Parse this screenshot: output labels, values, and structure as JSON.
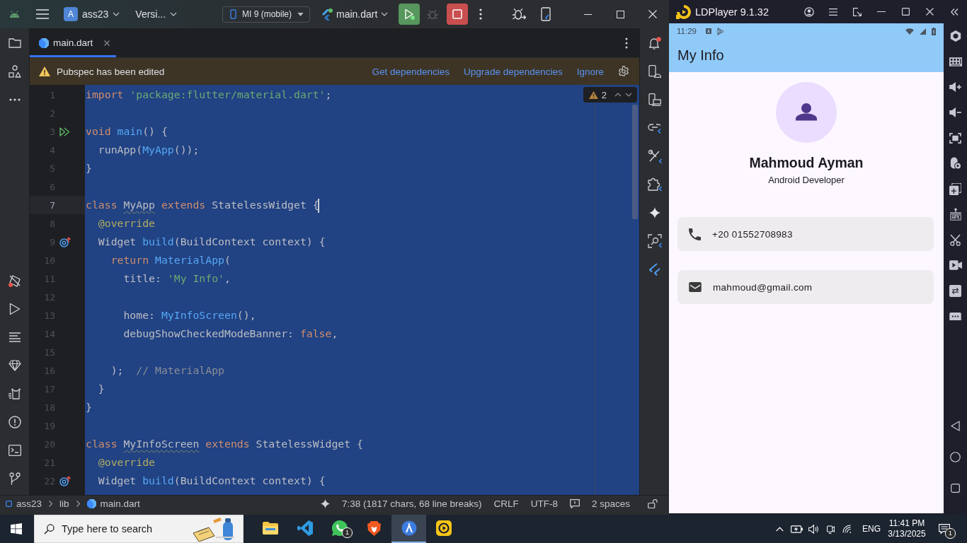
{
  "ide": {
    "title_bar": {
      "project_badge": "A",
      "project": "ass23",
      "vcs": "Versi...",
      "device": "MI 9 (mobile)",
      "run_config": "main.dart",
      "app_running": true,
      "actions": [
        {
          "kind": "run",
          "disabled": false
        },
        {
          "kind": "debug",
          "disabled": true
        },
        {
          "kind": "stop",
          "disabled": false
        }
      ]
    },
    "notifications": {
      "unread": true
    },
    "tabs": [
      {
        "label": "main.dart",
        "selected": true
      }
    ],
    "banner": {
      "message": "Pubspec has been edited",
      "actions": [
        "Get dependencies",
        "Upgrade dependencies",
        "Ignore"
      ]
    },
    "inspection": {
      "warnings": "2"
    },
    "code": {
      "lines": [
        {
          "number": "1",
          "kind": "plain",
          "current": false,
          "tokens": [
            {
              "text": "import ",
              "kind": "keyword"
            },
            {
              "text": "'package:flutter/material.dart'",
              "kind": "string"
            },
            {
              "text": ";",
              "kind": "plain"
            }
          ]
        },
        {
          "number": "2",
          "kind": "plain",
          "current": false
        },
        {
          "number": "3",
          "kind": "run",
          "current": false,
          "tokens": [
            {
              "text": "void ",
              "kind": "keyword"
            },
            {
              "text": "main",
              "kind": "function"
            },
            {
              "text": "() {",
              "kind": "plain"
            }
          ]
        },
        {
          "number": "4",
          "kind": "plain",
          "current": false,
          "tokens": [
            {
              "text": "  runApp(",
              "kind": "plain"
            },
            {
              "text": "MyApp",
              "kind": "function"
            },
            {
              "text": "());",
              "kind": "plain"
            }
          ]
        },
        {
          "number": "5",
          "kind": "plain",
          "current": false,
          "tokens": [
            {
              "text": "}",
              "kind": "plain"
            }
          ]
        },
        {
          "number": "6",
          "kind": "plain",
          "current": false
        },
        {
          "number": "7",
          "kind": "plain",
          "current": true,
          "tokens": [
            {
              "text": "class ",
              "kind": "keyword"
            },
            {
              "text": "MyApp",
              "kind": "warned"
            },
            {
              "text": " extends ",
              "kind": "keyword"
            },
            {
              "text": "StatelessWidget {",
              "kind": "plain"
            }
          ]
        },
        {
          "number": "8",
          "kind": "plain",
          "current": false,
          "tokens": [
            {
              "text": "  @override",
              "kind": "annotation"
            }
          ]
        },
        {
          "number": "9",
          "kind": "override",
          "current": false,
          "tokens": [
            {
              "text": "  Widget ",
              "kind": "plain"
            },
            {
              "text": "build",
              "kind": "function"
            },
            {
              "text": "(BuildContext context) {",
              "kind": "plain"
            }
          ]
        },
        {
          "number": "10",
          "kind": "plain",
          "current": false,
          "tokens": [
            {
              "text": "    return ",
              "kind": "keyword"
            },
            {
              "text": "MaterialApp",
              "kind": "function"
            },
            {
              "text": "(",
              "kind": "plain"
            }
          ]
        },
        {
          "number": "11",
          "kind": "plain",
          "current": false,
          "tokens": [
            {
              "text": "      title: ",
              "kind": "plain"
            },
            {
              "text": "'My Info'",
              "kind": "string"
            },
            {
              "text": ",",
              "kind": "plain"
            }
          ]
        },
        {
          "number": "12",
          "kind": "plain",
          "current": false
        },
        {
          "number": "13",
          "kind": "plain",
          "current": false,
          "tokens": [
            {
              "text": "      home: ",
              "kind": "plain"
            },
            {
              "text": "MyInfoScreen",
              "kind": "function"
            },
            {
              "text": "(),",
              "kind": "plain"
            }
          ]
        },
        {
          "number": "14",
          "kind": "plain",
          "current": false,
          "tokens": [
            {
              "text": "      debugShowCheckedModeBanner: ",
              "kind": "plain"
            },
            {
              "text": "false",
              "kind": "keyword"
            },
            {
              "text": ",",
              "kind": "plain"
            }
          ]
        },
        {
          "number": "15",
          "kind": "plain",
          "current": false
        },
        {
          "number": "16",
          "kind": "plain",
          "current": false,
          "tokens": [
            {
              "text": "    );",
              "kind": "plain"
            },
            {
              "text": "  // MaterialApp",
              "kind": "comment"
            }
          ]
        },
        {
          "number": "17",
          "kind": "plain",
          "current": false,
          "tokens": [
            {
              "text": "  }",
              "kind": "plain"
            }
          ]
        },
        {
          "number": "18",
          "kind": "plain",
          "current": false,
          "tokens": [
            {
              "text": "}",
              "kind": "plain"
            }
          ]
        },
        {
          "number": "19",
          "kind": "plain",
          "current": false
        },
        {
          "number": "20",
          "kind": "plain",
          "current": false,
          "tokens": [
            {
              "text": "class ",
              "kind": "keyword"
            },
            {
              "text": "MyInfoScreen",
              "kind": "warned"
            },
            {
              "text": " extends ",
              "kind": "keyword"
            },
            {
              "text": "StatelessWidget {",
              "kind": "plain"
            }
          ]
        },
        {
          "number": "21",
          "kind": "plain",
          "current": false,
          "tokens": [
            {
              "text": "  @override",
              "kind": "annotation"
            }
          ]
        },
        {
          "number": "22",
          "kind": "override",
          "current": false,
          "tokens": [
            {
              "text": "  Widget ",
              "kind": "plain"
            },
            {
              "text": "build",
              "kind": "function"
            },
            {
              "text": "(BuildContext context) {",
              "kind": "plain"
            }
          ]
        }
      ]
    },
    "status_bar": {
      "breadcrumbs": [
        {
          "label": "ass23",
          "kind": "module"
        },
        {
          "label": "lib",
          "kind": "folder"
        },
        {
          "label": "main.dart",
          "kind": "file"
        }
      ],
      "position": "7:38 (1817 chars, 68 line breaks)",
      "line_separator": "CRLF",
      "encoding": "UTF-8",
      "indent": "2 spaces"
    }
  },
  "emulator": {
    "title": "LDPlayer 9.1.32",
    "phone": {
      "time": "11:29",
      "app_title": "My Info",
      "profile": {
        "name": "Mahmoud Ayman",
        "role": "Android Developer"
      },
      "contacts": [
        {
          "kind": "phone",
          "text": "+20 01552708983"
        },
        {
          "kind": "email",
          "text": "mahmoud@gmail.com"
        }
      ]
    }
  },
  "taskbar": {
    "search": {
      "placeholder": "Type here to search"
    },
    "apps": [
      {
        "kind": "folder",
        "active": false
      },
      {
        "kind": "editor",
        "active": false
      },
      {
        "kind": "chat",
        "active": false,
        "badge": "1"
      },
      {
        "kind": "browser",
        "active": false
      },
      {
        "kind": "studio",
        "active": true
      },
      {
        "kind": "player",
        "active": false
      }
    ],
    "language": "ENG",
    "time": "11:41 PM",
    "date": "3/13/2025",
    "notifications": "1"
  }
}
